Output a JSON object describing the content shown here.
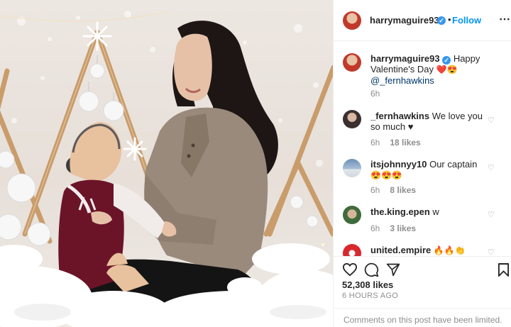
{
  "post_header": {
    "username": "harrymaguire93",
    "separator": "•",
    "follow_label": "Follow",
    "more_icon": "more-options-icon"
  },
  "caption": {
    "username": "harrymaguire93",
    "text": "Happy Valentine's Day",
    "emojis": "❤️😍",
    "mention": "@_fernhawkins",
    "time": "6h"
  },
  "comments": [
    {
      "username": "_fernhawkins",
      "text": "We love you so much ♥",
      "time": "6h",
      "likes": "18 likes"
    },
    {
      "username": "itsjohnnyy10",
      "text": "Our captain",
      "emojis": "😍😍😍",
      "time": "6h",
      "likes": "8 likes"
    },
    {
      "username": "the.king.epen",
      "text": "w",
      "time": "6h",
      "likes": "3 likes"
    },
    {
      "username": "united.empire",
      "emojis": "🔥🔥👏"
    }
  ],
  "actions": {
    "like_icon": "heart-icon",
    "comment_icon": "comment-icon",
    "share_icon": "share-icon",
    "save_icon": "bookmark-icon"
  },
  "likes_count": "52,308 likes",
  "post_age": "6 HOURS AGO",
  "comments_notice": "Comments on this post have been limited.",
  "colors": {
    "follow_blue": "#0095f6",
    "verified_blue": "#3897f0",
    "secondary_text": "#8e8e8e",
    "mention": "#00376b"
  }
}
